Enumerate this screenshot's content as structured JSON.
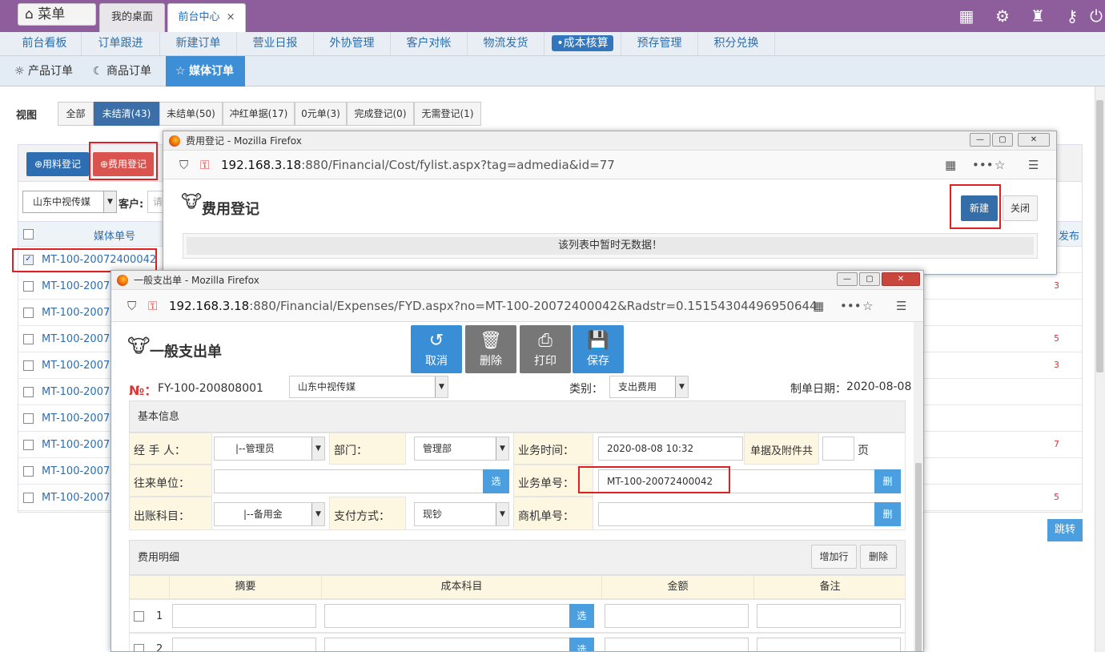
{
  "topbar": {
    "menu_label": "菜单",
    "tabs": [
      {
        "label": "我的桌面"
      },
      {
        "label": "前台中心",
        "close": "×"
      }
    ]
  },
  "nav2": [
    "前台看板",
    "订单跟进",
    "新建订单",
    "营业日报",
    "外协管理",
    "客户对帐",
    "物流发货",
    "•成本核算",
    "预存管理",
    "积分兑换"
  ],
  "nav3": [
    "产品订单",
    "商品订单",
    "媒体订单"
  ],
  "view": {
    "label": "视图",
    "buttons": [
      "全部",
      "未结清(43)",
      "未结单(50)",
      "冲红单据(17)",
      "0元单(3)",
      "完成登记(0)",
      "无需登记(1)"
    ]
  },
  "list": {
    "btn_material": "⊕用料登记",
    "btn_cost": "⊕费用登记",
    "company_select": "山东中视传媒",
    "customer_label": "客户:",
    "customer_placeholder": "请",
    "col_media_no": "媒体单号",
    "col_right_partial": "发布",
    "first_row": "MT-100-20072400042",
    "rows": [
      "MT-100-2007",
      "MT-100-2007",
      "MT-100-2007",
      "MT-100-2007",
      "MT-100-2007",
      "MT-100-2007",
      "MT-100-2007",
      "MT-100-2007",
      "MT-100-2007"
    ],
    "right_vals": [
      "3",
      "5",
      "3",
      "7",
      "5"
    ],
    "jump_btn": "跳转"
  },
  "win1": {
    "title": "费用登记 - Mozilla Firefox",
    "url_host": "192.168.3.18",
    "url_rest": ":880/Financial/Cost/fylist.aspx?tag=admedia&id=77",
    "page_title": "费用登记",
    "btn_new": "新建",
    "btn_close": "关闭",
    "empty_msg": "该列表中暂时无数据！"
  },
  "win2": {
    "title": "一般支出单 - Mozilla Firefox",
    "url_host": "192.168.3.18",
    "url_rest": ":880/Financial/Expenses/FYD.aspx?no=MT-100-20072400042&Radstr=0.15154304496950644",
    "page_title": "一般支出单",
    "toolbar": [
      {
        "label": "取消",
        "icon": "↺"
      },
      {
        "label": "删除",
        "icon": "🗑"
      },
      {
        "label": "打印",
        "icon": "⎙"
      },
      {
        "label": "保存",
        "icon": "💾"
      }
    ],
    "no_label": "№：",
    "no_value": "FY-100-200808001",
    "company": "山东中视传媒",
    "category_label": "类别：",
    "category_value": "支出费用",
    "date_label": "制单日期：",
    "date_value": "2020-08-08",
    "basic_info": "基本信息",
    "handler_label": "经 手 人：",
    "handler_value": "|--管理员",
    "dept_label": "部门：",
    "dept_value": "管理部",
    "biztime_label": "业务时间：",
    "biztime_value": "2020-08-08 10:32",
    "attach_label": "单据及附件共",
    "attach_unit": "页",
    "partner_label": "往来单位：",
    "select_btn": "选",
    "bizno_label": "业务单号：",
    "bizno_value": "MT-100-20072400042",
    "del_btn": "删",
    "account_label": "出账科目：",
    "account_value": "|--备用金",
    "paytype_label": "支付方式：",
    "paytype_value": "现钞",
    "merchant_label": "商机单号：",
    "detail_title": "费用明细",
    "add_row": "增加行",
    "delete": "删除",
    "cols": [
      "摘要",
      "成本科目",
      "金额",
      "备注"
    ],
    "row_nums": [
      "1",
      "2"
    ]
  }
}
